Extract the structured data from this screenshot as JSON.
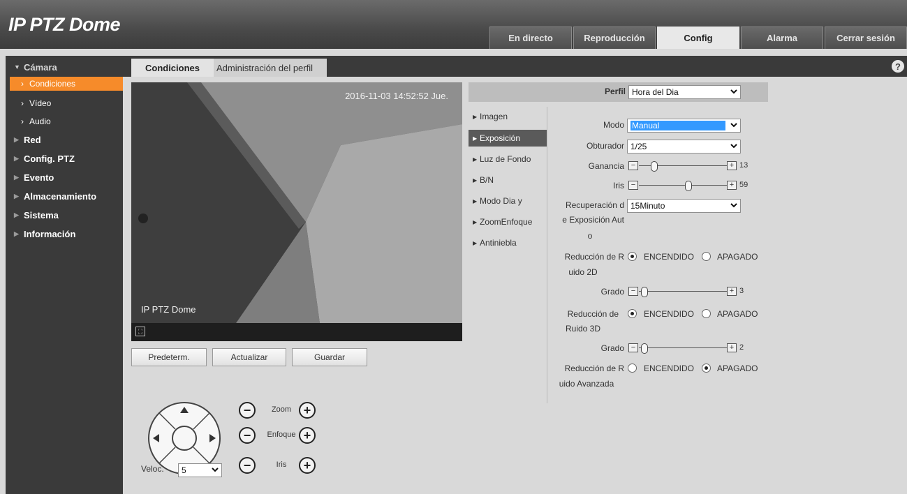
{
  "app": {
    "title": "IP PTZ Dome"
  },
  "main_tabs": [
    {
      "label": "En directo",
      "active": false
    },
    {
      "label": "Reproducción",
      "active": false
    },
    {
      "label": "Config",
      "active": true
    },
    {
      "label": "Alarma",
      "active": false
    },
    {
      "label": "Cerrar sesión",
      "active": false
    }
  ],
  "nav": {
    "camera": "Cámara",
    "sub": [
      "Condiciones",
      "Vídeo",
      "Audio"
    ],
    "red": "Red",
    "ptz": "Config. PTZ",
    "evento": "Evento",
    "almacenamiento": "Almacenamiento",
    "sistema": "Sistema",
    "informacion": "Información"
  },
  "sub_tabs": [
    "Condiciones",
    "Administración del perfil"
  ],
  "help_icon": "?",
  "video": {
    "timestamp": "2016-11-03 14:52:52 Jue.",
    "osd_name": "IP PTZ Dome",
    "fullscreen_icon": "fullscreen-icon"
  },
  "buttons": {
    "default": "Predeterm.",
    "refresh": "Actualizar",
    "save": "Guardar"
  },
  "ptz": {
    "zoom": "Zoom",
    "focus": "Enfoque",
    "iris": "Iris",
    "speed_label": "Veloc.",
    "speed_value": "5"
  },
  "profile": {
    "label": "Perfil",
    "value": "Hora del Dia"
  },
  "categories": [
    "Imagen",
    "Exposición",
    "Luz de Fondo",
    "B/N",
    "Modo Dia y",
    "ZoomEnfoque",
    "Antiniebla"
  ],
  "exposure": {
    "mode_label": "Modo",
    "mode_value": "Manual",
    "shutter_label": "Obturador",
    "shutter_value": "1/25",
    "gain_label": "Ganancia",
    "gain_value": "13",
    "iris_label": "Iris",
    "iris_value": "59",
    "recovery_label_1": "Recuperación d",
    "recovery_label_2": "e Exposición Aut",
    "recovery_label_3": "o",
    "recovery_value": "15Minuto",
    "nr2d_label_1": "Reducción de R",
    "nr2d_label_2": "uido 2D",
    "nr2d_state": "on",
    "grade_label": "Grado",
    "nr2d_grade": "3",
    "nr3d_label_1": "Reducción de",
    "nr3d_label_2": "Ruido 3D",
    "nr3d_state": "on",
    "nr3d_grade": "2",
    "nradv_label_1": "Reducción de R",
    "nradv_label_2": "uido Avanzada",
    "nradv_state": "off",
    "on_label": "ENCENDIDO",
    "off_label": "APAGADO"
  },
  "colors": {
    "accent": "#f68b2a",
    "nav_bg": "#3a3a3a",
    "content_bg": "#d9d9d9"
  }
}
